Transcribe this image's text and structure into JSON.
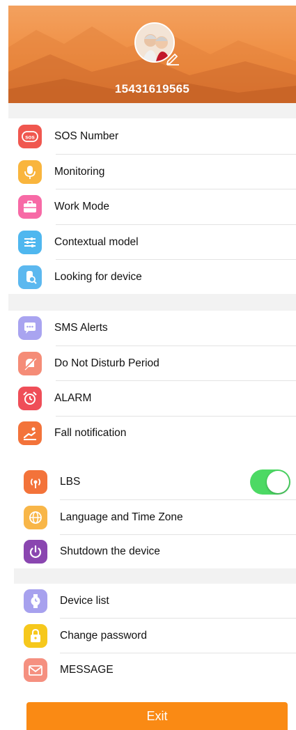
{
  "profile": {
    "phone": "15431619565"
  },
  "colors": {
    "header": "#ef8c3f",
    "accent": "#fa8a14",
    "toggle_on": "#4cd964"
  },
  "group1": [
    {
      "label": "SOS Number",
      "icon": "sos-icon",
      "color": "#f0574f"
    },
    {
      "label": "Monitoring",
      "icon": "microphone-icon",
      "color": "#f9b53d"
    },
    {
      "label": "Work Mode",
      "icon": "briefcase-icon",
      "color": "#f76aa6"
    },
    {
      "label": "Contextual model",
      "icon": "sliders-icon",
      "color": "#4fb7ef"
    },
    {
      "label": "Looking for device",
      "icon": "find-device-icon",
      "color": "#5cb8ef"
    }
  ],
  "group2": [
    {
      "label": "SMS Alerts",
      "icon": "chat-bubble-icon",
      "color": "#a9a4f0"
    },
    {
      "label": "Do Not Disturb Period",
      "icon": "bell-off-icon",
      "color": "#f58c77"
    },
    {
      "label": "ALARM",
      "icon": "alarm-clock-icon",
      "color": "#ef4e58"
    },
    {
      "label": "Fall notification",
      "icon": "fall-person-icon",
      "color": "#f3733a"
    }
  ],
  "group3": [
    {
      "label": "LBS",
      "icon": "location-signal-icon",
      "color": "#f3733a"
    },
    {
      "label": "Language and Time Zone",
      "icon": "globe-icon",
      "color": "#f8b648"
    },
    {
      "label": "Shutdown the device",
      "icon": "power-icon",
      "color": "#8a46b0"
    }
  ],
  "group4": [
    {
      "label": "Device list",
      "icon": "watch-icon",
      "color": "#a7a1ee"
    },
    {
      "label": "Change password",
      "icon": "lock-icon",
      "color": "#f6c81c"
    },
    {
      "label": "MESSAGE",
      "icon": "envelope-icon",
      "color": "#f59080"
    }
  ],
  "lbs_enabled": true,
  "exit_label": "Exit"
}
